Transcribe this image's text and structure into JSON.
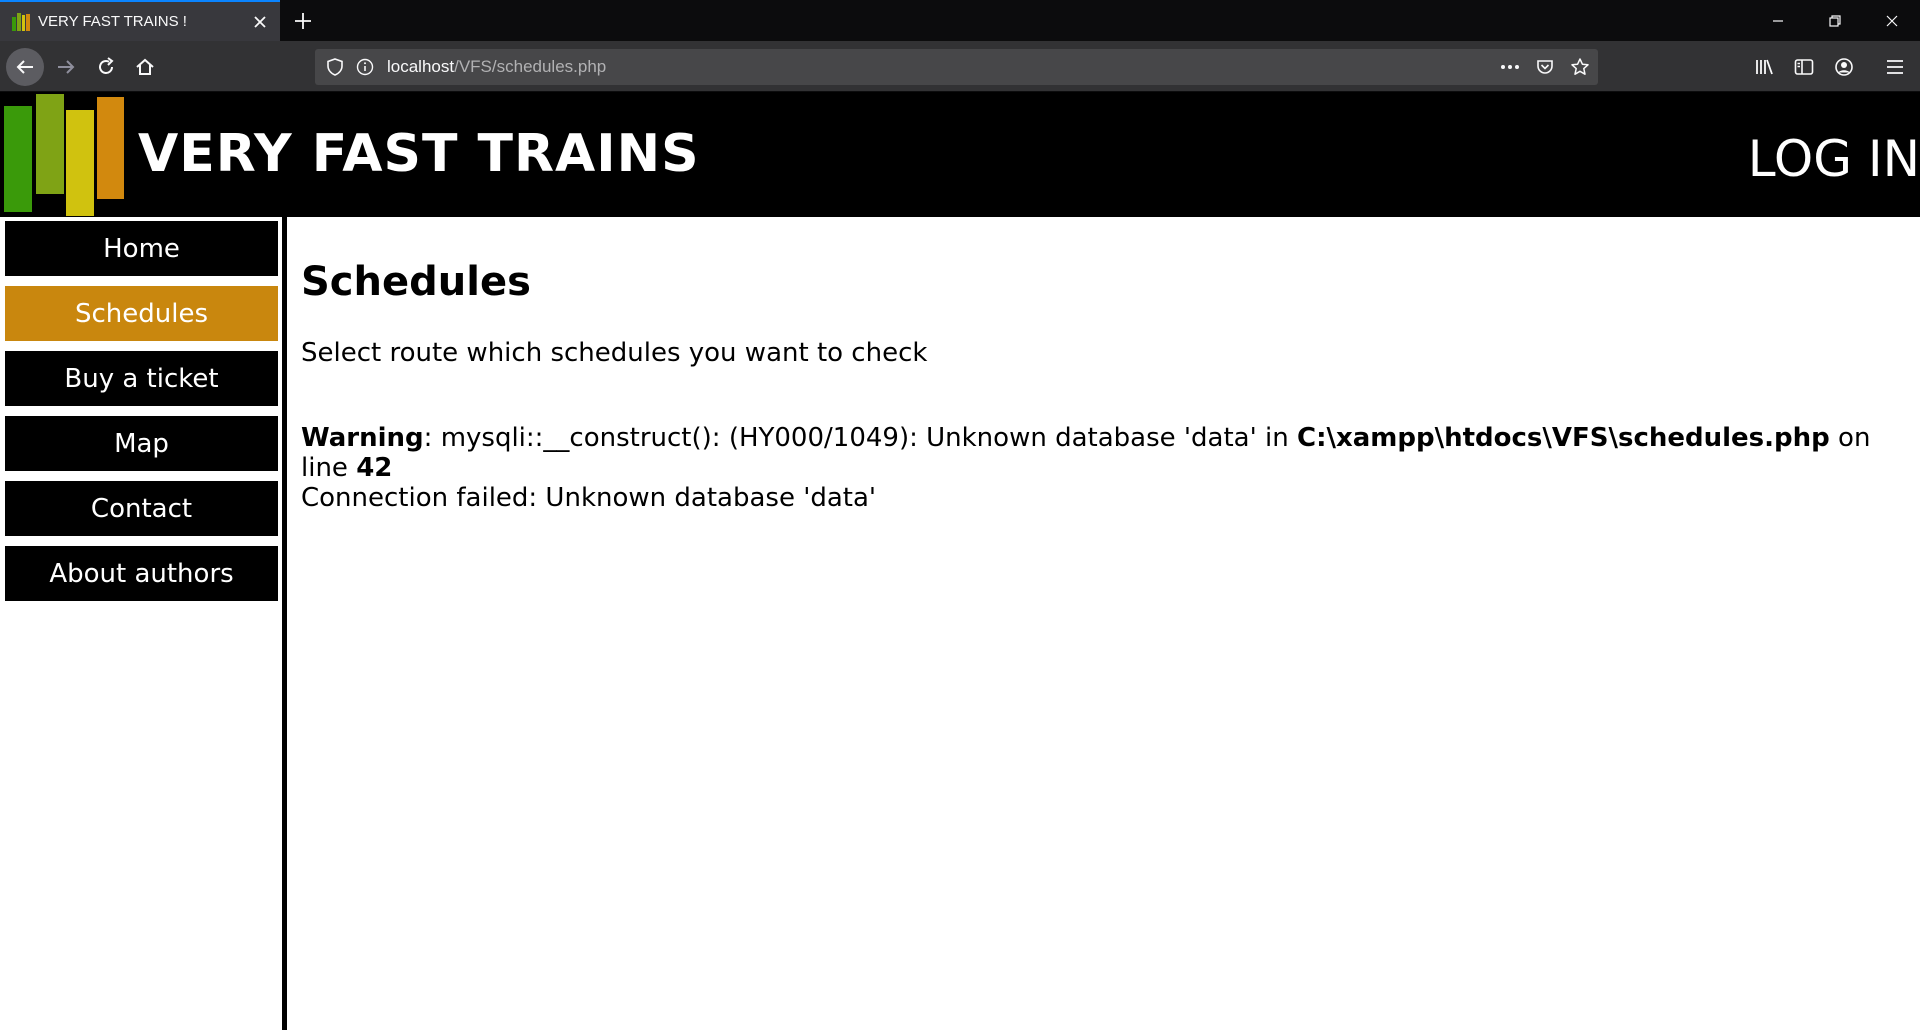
{
  "browser": {
    "tab_title": "VERY FAST TRAINS !",
    "url_host": "localhost",
    "url_path": "/VFS/schedules.php"
  },
  "header": {
    "brand": "VERY FAST TRAINS",
    "login": "LOG IN",
    "logo_colors": [
      "#3a9a0a",
      "#7fa315",
      "#d0c20f",
      "#d2890e"
    ]
  },
  "sidebar": {
    "items": [
      {
        "label": "Home",
        "active": false
      },
      {
        "label": "Schedules",
        "active": true
      },
      {
        "label": "Buy a ticket",
        "active": false
      },
      {
        "label": "Map",
        "active": false
      },
      {
        "label": "Contact",
        "active": false
      },
      {
        "label": "About authors",
        "active": false
      }
    ],
    "active_color": "#c9870e"
  },
  "main": {
    "title": "Schedules",
    "intro": "Select route which schedules you want to check",
    "warning": {
      "label": "Warning",
      "message": ": mysqli::__construct(): (HY000/1049): Unknown database 'data' in ",
      "file": "C:\\xampp\\htdocs\\VFS\\schedules.php",
      "on_line": " on line ",
      "line": "42",
      "connection_error": "Connection failed: Unknown database 'data'"
    }
  }
}
